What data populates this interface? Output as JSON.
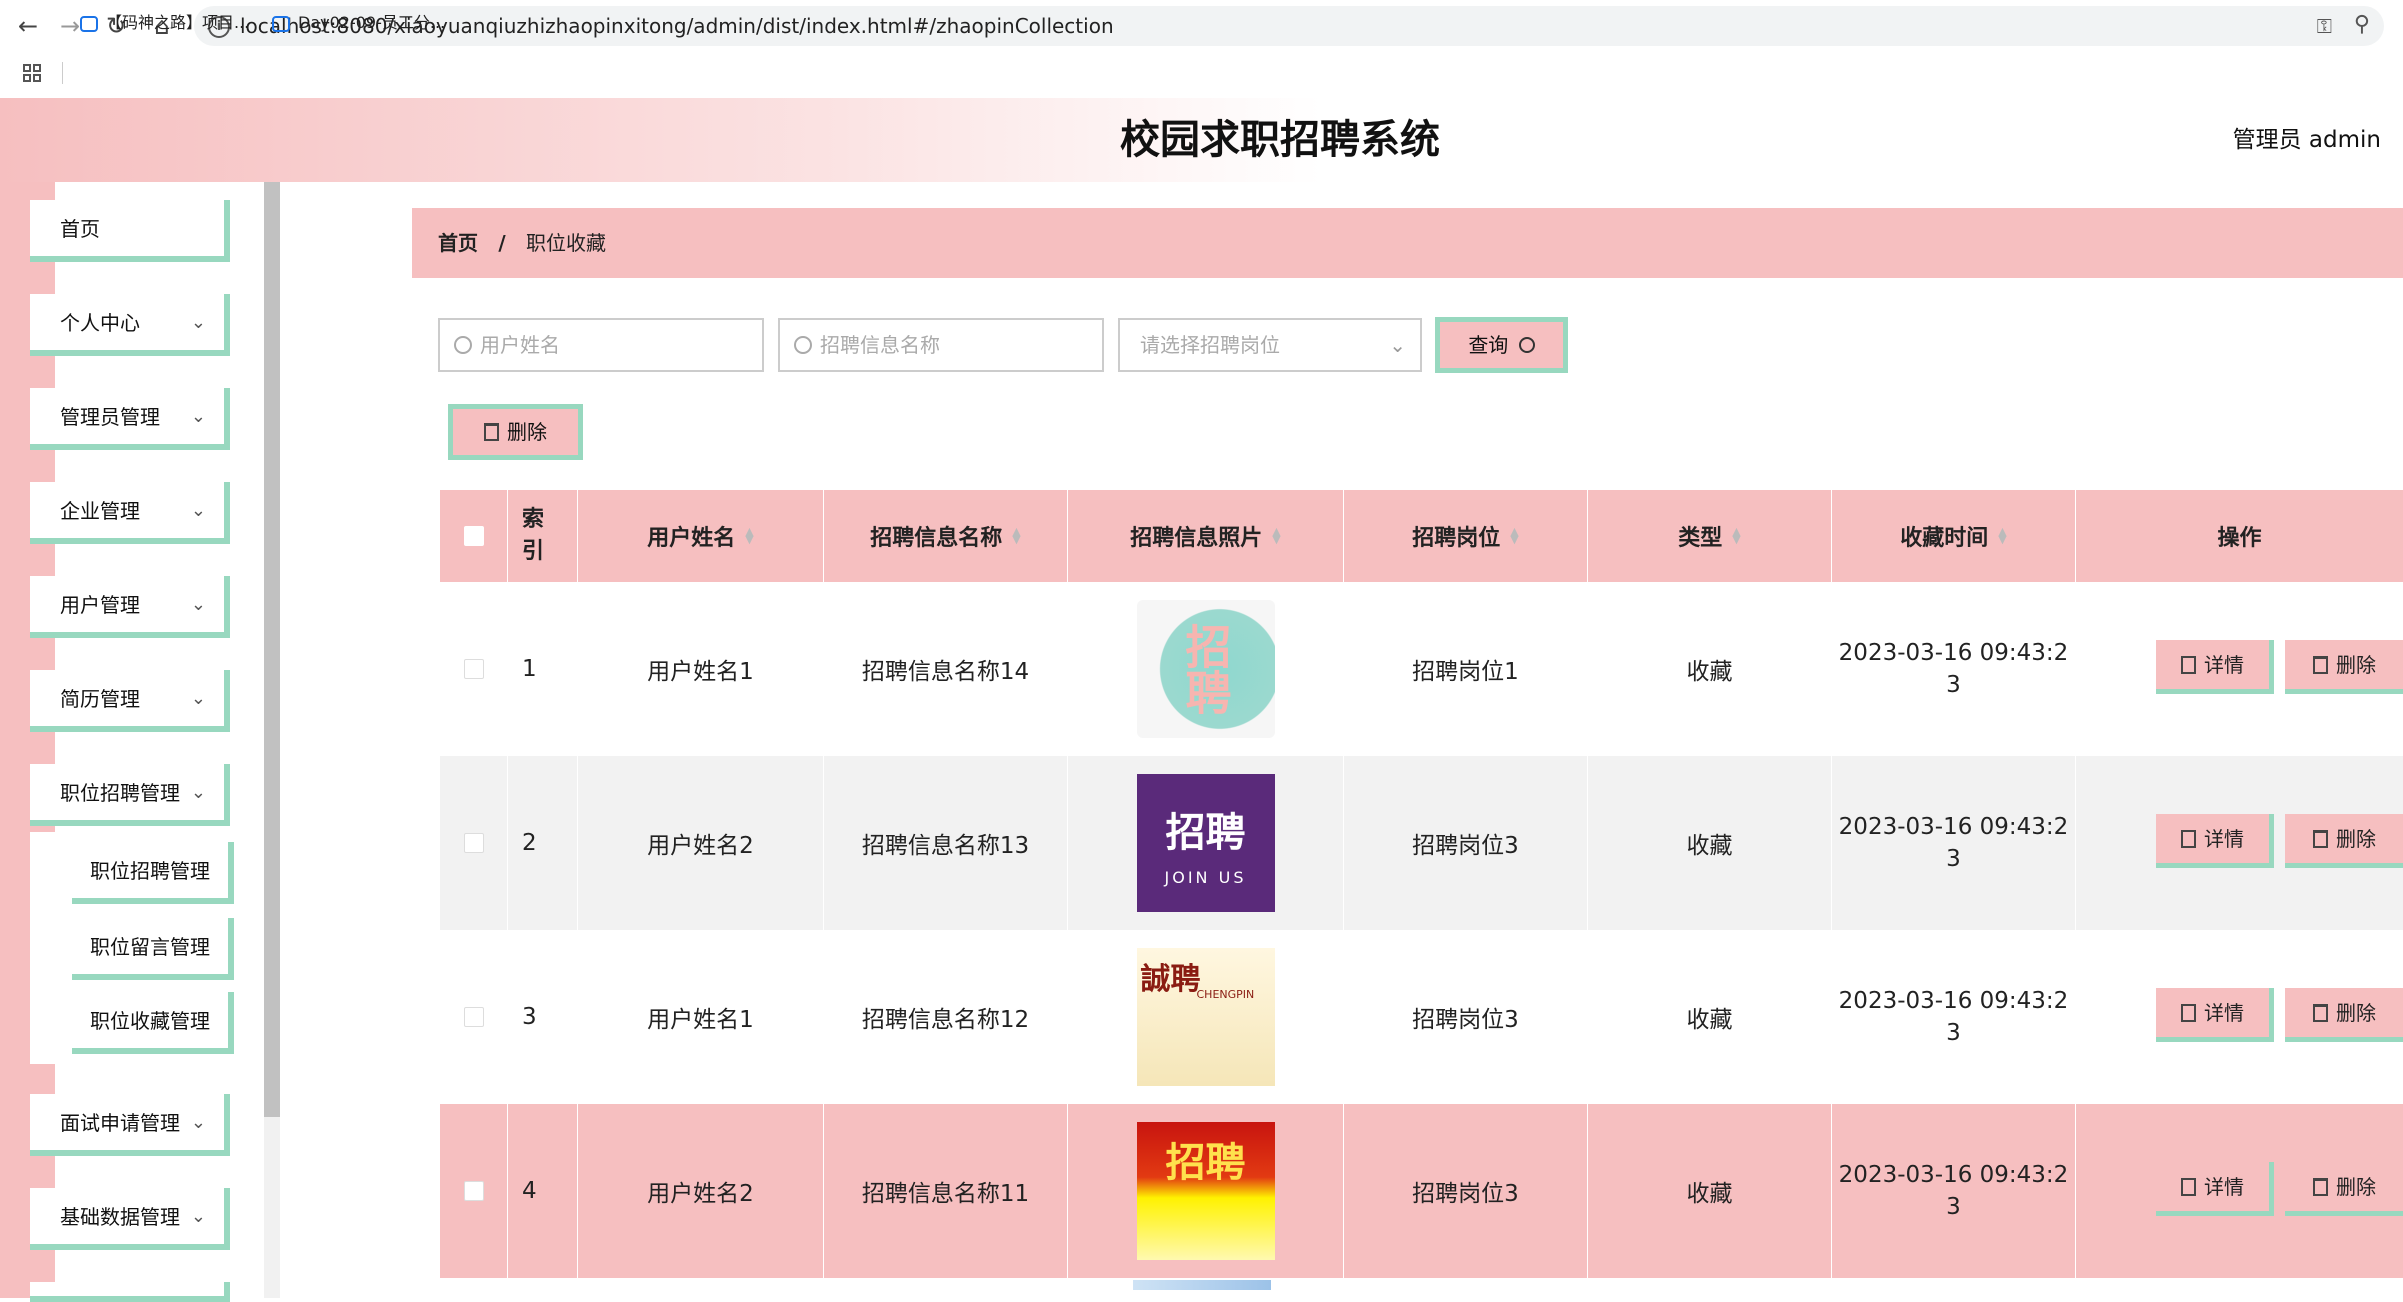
{
  "browser": {
    "url": "localhost:8080/xiaoyuanqiuzhizhaopinxitong/admin/dist/index.html#/zhaopinCollection",
    "bookmarks": [
      "【码神之路】项目...",
      "Day02-09-员工分..."
    ]
  },
  "header": {
    "title": "校园求职招聘系统",
    "user": "管理员 admin"
  },
  "sidebar": {
    "items": [
      {
        "label": "首页",
        "expandable": false
      },
      {
        "label": "个人中心",
        "expandable": true
      },
      {
        "label": "管理员管理",
        "expandable": true
      },
      {
        "label": "企业管理",
        "expandable": true
      },
      {
        "label": "用户管理",
        "expandable": true
      },
      {
        "label": "简历管理",
        "expandable": true
      },
      {
        "label": "职位招聘管理",
        "expandable": true
      }
    ],
    "subitems": [
      "职位招聘管理",
      "职位留言管理",
      "职位收藏管理"
    ],
    "items_after": [
      {
        "label": "面试申请管理",
        "expandable": true
      },
      {
        "label": "基础数据管理",
        "expandable": true
      }
    ]
  },
  "breadcrumb": {
    "home": "首页",
    "separator": "/",
    "current": "职位收藏"
  },
  "filters": {
    "username_placeholder": "用户姓名",
    "info_name_placeholder": "招聘信息名称",
    "position_placeholder": "请选择招聘岗位",
    "query_label": "查询"
  },
  "toolbar": {
    "delete_label": "删除"
  },
  "table": {
    "headers": {
      "index": "索引",
      "username": "用户姓名",
      "info_name": "招聘信息名称",
      "photo": "招聘信息照片",
      "position": "招聘岗位",
      "type": "类型",
      "time": "收藏时间",
      "actions": "操作"
    },
    "rows": [
      {
        "index": "1",
        "username": "用户姓名1",
        "info_name": "招聘信息名称14",
        "photo_text": "招聘",
        "position": "招聘岗位1",
        "type": "收藏",
        "time_line1": "2023-03-16 09:43:2",
        "time_line2": "3"
      },
      {
        "index": "2",
        "username": "用户姓名2",
        "info_name": "招聘信息名称13",
        "photo_text": "招聘",
        "photo_sub": "JOIN US",
        "position": "招聘岗位3",
        "type": "收藏",
        "time_line1": "2023-03-16 09:43:2",
        "time_line2": "3"
      },
      {
        "index": "3",
        "username": "用户姓名1",
        "info_name": "招聘信息名称12",
        "photo_text": "誠聘",
        "photo_sub": "CHENGPIN",
        "position": "招聘岗位3",
        "type": "收藏",
        "time_line1": "2023-03-16 09:43:2",
        "time_line2": "3"
      },
      {
        "index": "4",
        "username": "用户姓名2",
        "info_name": "招聘信息名称11",
        "photo_text": "招聘",
        "position": "招聘岗位3",
        "type": "收藏",
        "time_line1": "2023-03-16 09:43:2",
        "time_line2": "3"
      }
    ],
    "detail_label": "详情",
    "delete_label": "删除"
  }
}
